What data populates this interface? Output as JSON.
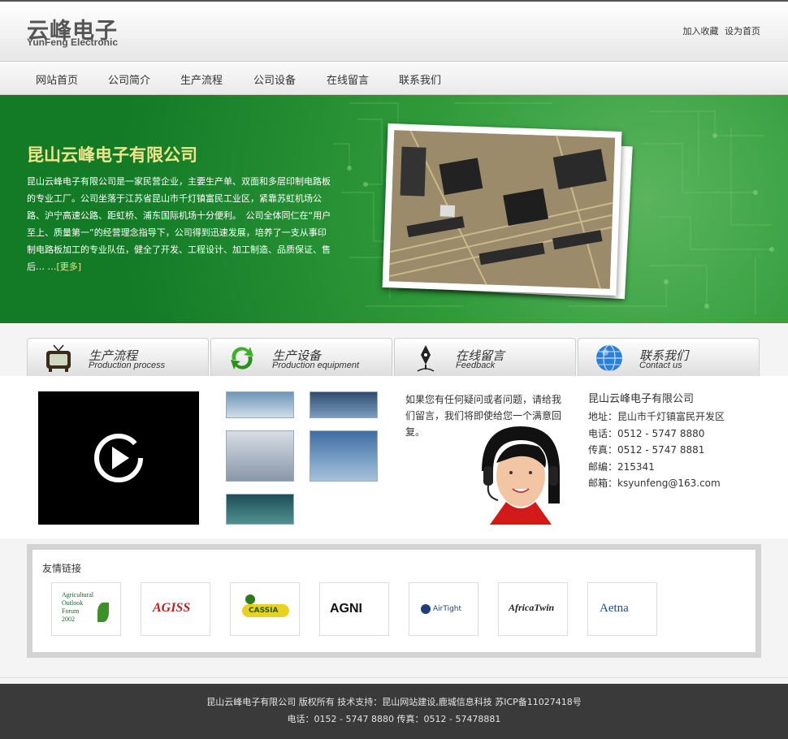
{
  "header": {
    "logo_cn": "云峰电子",
    "logo_en": "YunFeng Electronic",
    "bookmark": "加入收藏",
    "homepage": "设为首页"
  },
  "nav": {
    "items": [
      "网站首页",
      "公司简介",
      "生产流程",
      "公司设备",
      "在线留言",
      "联系我们"
    ]
  },
  "banner": {
    "title": "昆山云峰电子有限公司",
    "text": "昆山云峰电子有限公司是一家民营企业，主要生产单、双面和多层印制电路板的专业工厂。公司坐落于江苏省昆山市千灯镇富民工业区，紧靠苏虹机场公路、沪宁高速公路、距虹桥、浦东国际机场十分便利。　公司全体同仁在“用户至上、质量第一”的经营理念指导下，公司得到迅速发展，培养了一支从事印制电路板加工的专业队伍，健全了开发、工程设计、加工制造、品质保证、售后… …",
    "more": "[更多]"
  },
  "tabs": [
    {
      "cn": "生产流程",
      "en": "Production process",
      "icon": "tv-icon"
    },
    {
      "cn": "生产设备",
      "en": "Production equipment",
      "icon": "recycle-arrows-icon"
    },
    {
      "cn": "在线留言",
      "en": "Feedback",
      "icon": "pen-nib-icon"
    },
    {
      "cn": "联系我们",
      "en": "Contact us",
      "icon": "globe-icon"
    }
  ],
  "feedback": {
    "text": "如果您有任何疑问或者问题，请给我们留言，我们将即使给您一个满意回复。"
  },
  "contact": {
    "title": "昆山云峰电子有限公司",
    "rows": [
      "地址：昆山市千灯镇富民开发区",
      "电话：0512 - 5747 8880",
      "传真：0512 - 5747 8881",
      "邮编：215341",
      "邮箱：ksyunfeng@163.com"
    ]
  },
  "links": {
    "title": "友情链接",
    "logos": [
      {
        "line1": "Agricultural",
        "line2": "Outlook",
        "line3": "Forum",
        "line4": "2002"
      },
      {
        "text": "AGISS"
      },
      {
        "text": "CASSIA"
      },
      {
        "text": "AGNI"
      },
      {
        "text": "AirTight"
      },
      {
        "text": "AfricaTwin"
      },
      {
        "text": "Aetna"
      }
    ]
  },
  "footer": {
    "line1": "昆山云峰电子有限公司 版权所有  技术支持：昆山网站建设,鹿城信息科技  苏ICP备11027418号",
    "line2": "电话：0152 - 5747 8880 传真：0512 - 57478881"
  },
  "colors": {
    "banner_green": "#2f9a3a",
    "banner_title": "#f0e58a",
    "footer_bg": "#3a3a3a"
  }
}
